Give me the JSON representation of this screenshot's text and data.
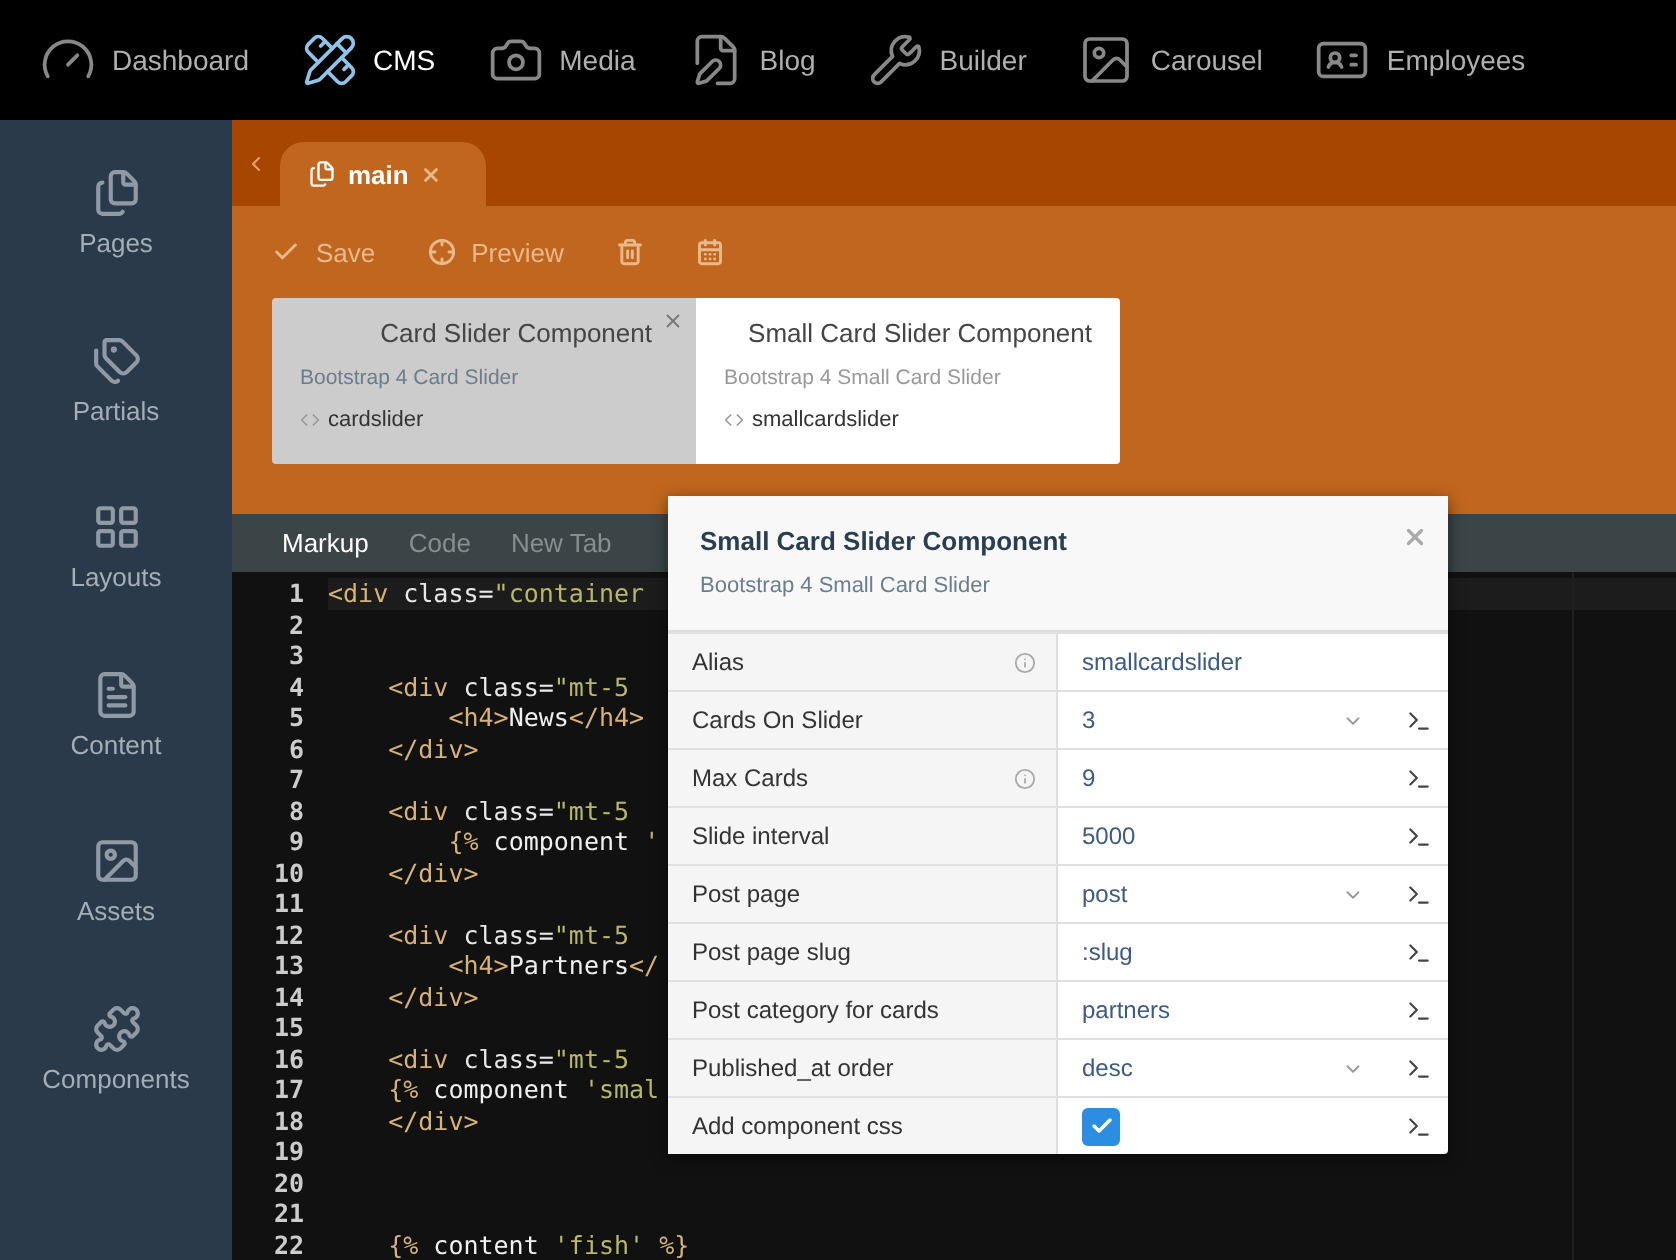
{
  "top_nav": [
    {
      "label": "Dashboard",
      "selected": false
    },
    {
      "label": "CMS",
      "selected": true
    },
    {
      "label": "Media",
      "selected": false
    },
    {
      "label": "Blog",
      "selected": false
    },
    {
      "label": "Builder",
      "selected": false
    },
    {
      "label": "Carousel",
      "selected": false
    },
    {
      "label": "Employees",
      "selected": false
    }
  ],
  "sidebar": {
    "items": [
      {
        "label": "Pages"
      },
      {
        "label": "Partials"
      },
      {
        "label": "Layouts"
      },
      {
        "label": "Content"
      },
      {
        "label": "Assets"
      },
      {
        "label": "Components"
      }
    ]
  },
  "document_tab": {
    "label": "main"
  },
  "toolbar": {
    "buttons": [
      {
        "label": "Save"
      },
      {
        "label": "Preview"
      }
    ]
  },
  "components": [
    {
      "title": "Card Slider Component",
      "description": "Bootstrap 4 Card Slider",
      "alias": "cardslider",
      "selected": false,
      "closable": true
    },
    {
      "title": "Small Card Slider Component",
      "description": "Bootstrap 4 Small Card Slider",
      "alias": "smallcardslider",
      "selected": true,
      "closable": false
    }
  ],
  "editor_tabs": [
    {
      "label": "Markup",
      "selected": true
    },
    {
      "label": "Code",
      "selected": false
    },
    {
      "label": "New Tab",
      "selected": false
    }
  ],
  "code_lines": [
    {
      "number": "1",
      "tokens": [
        {
          "kind": "tag",
          "text": "<div"
        },
        {
          "kind": "attr",
          "text": " class"
        },
        {
          "kind": "punct",
          "text": "="
        },
        {
          "kind": "str",
          "text": "\"container"
        }
      ]
    },
    {
      "number": "2"
    },
    {
      "number": "3"
    },
    {
      "number": "4",
      "tokens": [
        {
          "kind": "tag",
          "text": "    <div"
        },
        {
          "kind": "attr",
          "text": " class"
        },
        {
          "kind": "punct",
          "text": "="
        },
        {
          "kind": "str",
          "text": "\"mt-5"
        }
      ]
    },
    {
      "number": "5",
      "tokens": [
        {
          "kind": "tag",
          "text": "        <h4>"
        },
        {
          "kind": "text",
          "text": "News"
        },
        {
          "kind": "tag",
          "text": "</h4>"
        }
      ]
    },
    {
      "number": "6",
      "tokens": [
        {
          "kind": "tag",
          "text": "    </div>"
        }
      ]
    },
    {
      "number": "7"
    },
    {
      "number": "8",
      "tokens": [
        {
          "kind": "tag",
          "text": "    <div"
        },
        {
          "kind": "attr",
          "text": " class"
        },
        {
          "kind": "punct",
          "text": "="
        },
        {
          "kind": "str",
          "text": "\"mt-5"
        }
      ]
    },
    {
      "number": "9",
      "tokens": [
        {
          "kind": "twig",
          "text": "        {%"
        },
        {
          "kind": "text",
          "text": " component "
        },
        {
          "kind": "str",
          "text": "'"
        }
      ]
    },
    {
      "number": "10",
      "tokens": [
        {
          "kind": "tag",
          "text": "    </div>"
        }
      ]
    },
    {
      "number": "11"
    },
    {
      "number": "12",
      "tokens": [
        {
          "kind": "tag",
          "text": "    <div"
        },
        {
          "kind": "attr",
          "text": " class"
        },
        {
          "kind": "punct",
          "text": "="
        },
        {
          "kind": "str",
          "text": "\"mt-5"
        }
      ]
    },
    {
      "number": "13",
      "tokens": [
        {
          "kind": "tag",
          "text": "        <h4>"
        },
        {
          "kind": "text",
          "text": "Partners"
        },
        {
          "kind": "tag",
          "text": "</"
        }
      ]
    },
    {
      "number": "14",
      "tokens": [
        {
          "kind": "tag",
          "text": "    </div>"
        }
      ]
    },
    {
      "number": "15"
    },
    {
      "number": "16",
      "tokens": [
        {
          "kind": "tag",
          "text": "    <div"
        },
        {
          "kind": "attr",
          "text": " class"
        },
        {
          "kind": "punct",
          "text": "="
        },
        {
          "kind": "str",
          "text": "\"mt-5"
        }
      ]
    },
    {
      "number": "17",
      "tokens": [
        {
          "kind": "twig",
          "text": "    {%"
        },
        {
          "kind": "text",
          "text": " component "
        },
        {
          "kind": "str",
          "text": "'smal"
        }
      ]
    },
    {
      "number": "18",
      "tokens": [
        {
          "kind": "tag",
          "text": "    </div>"
        }
      ]
    },
    {
      "number": "19"
    },
    {
      "number": "20"
    },
    {
      "number": "21"
    },
    {
      "number": "22",
      "tokens": [
        {
          "kind": "twig",
          "text": "    {%"
        },
        {
          "kind": "text",
          "text": " content "
        },
        {
          "kind": "str",
          "text": "'fish'"
        },
        {
          "kind": "twig",
          "text": " %}"
        }
      ]
    }
  ],
  "inspector": {
    "title": "Small Card Slider Component",
    "description": "Bootstrap 4 Small Card Slider",
    "properties": [
      {
        "label": "Alias",
        "kind": "text",
        "value": "smallcardslider",
        "info": true,
        "linkable": false
      },
      {
        "label": "Cards On Slider",
        "kind": "dropdown",
        "value": "3",
        "info": false,
        "linkable": true
      },
      {
        "label": "Max Cards",
        "kind": "text",
        "value": "9",
        "info": true,
        "linkable": true
      },
      {
        "label": "Slide interval",
        "kind": "text",
        "value": "5000",
        "info": false,
        "linkable": true
      },
      {
        "label": "Post page",
        "kind": "dropdown",
        "value": "post",
        "info": false,
        "linkable": true
      },
      {
        "label": "Post page slug",
        "kind": "text",
        "value": ":slug",
        "info": false,
        "linkable": true
      },
      {
        "label": "Post category for cards",
        "kind": "text",
        "value": "partners",
        "info": false,
        "linkable": true
      },
      {
        "label": "Published_at order",
        "kind": "dropdown",
        "value": "desc",
        "info": false,
        "linkable": true
      },
      {
        "label": "Add component css",
        "kind": "checkbox",
        "checked": true,
        "info": false,
        "linkable": true
      }
    ]
  }
}
